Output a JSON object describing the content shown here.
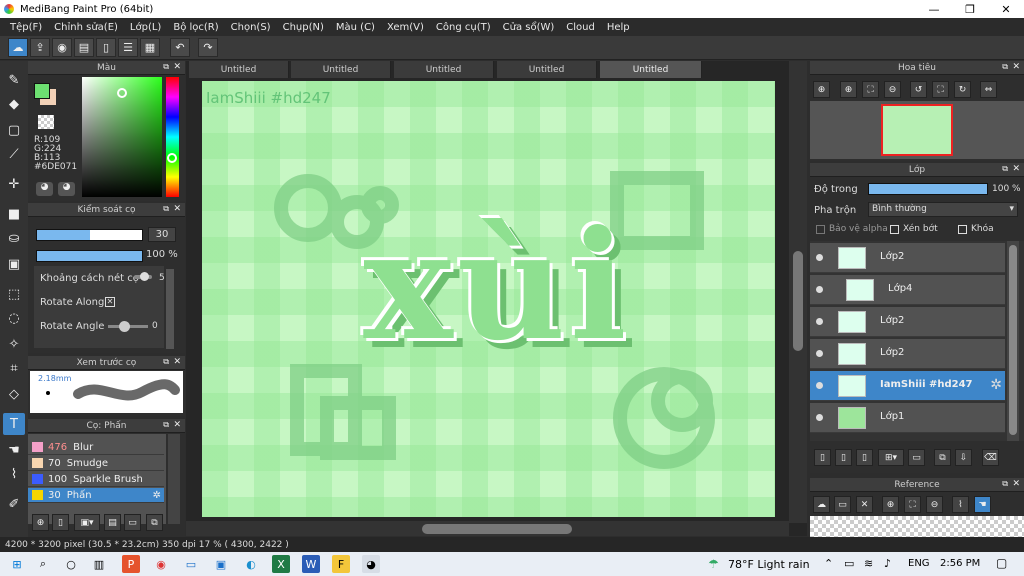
{
  "window": {
    "title": "MediBang Paint Pro (64bit)",
    "minimize": "—",
    "maximize": "❐",
    "close": "✕"
  },
  "menu": [
    "Tệp(F)",
    "Chỉnh sửa(E)",
    "Lớp(L)",
    "Bộ lọc(R)",
    "Chọn(S)",
    "Chụp(N)",
    "Màu (C)",
    "Xem(V)",
    "Công cụ(T)",
    "Cửa sổ(W)",
    "Cloud",
    "Help"
  ],
  "tabs": [
    "Untitled",
    "Untitled",
    "Untitled",
    "Untitled",
    "Untitled"
  ],
  "color_panel": {
    "title": "Màu",
    "r": "R:109",
    "g": "G:224",
    "b": "B:113",
    "hex": "#6DE071",
    "fg": "#6de071",
    "bg": "#f2d1b7"
  },
  "brush_control": {
    "title": "Kiểm soát cọ",
    "size": "30",
    "opacity_pct": "100 %",
    "size_fraction": 0.5,
    "opacity_fraction": 1.0,
    "spacing_label": "Khoảng cách nét cọ",
    "spacing_value": "5",
    "rotate_along_label": "Rotate Along",
    "rotate_angle_label": "Rotate Angle",
    "rotate_angle_value": "0"
  },
  "preview": {
    "title": "Xem trước cọ",
    "size": "2.18mm"
  },
  "brush_list": {
    "title": "Cọ: Phấn",
    "items": [
      {
        "num": "476",
        "name": "Blur",
        "color": "#f4a0c8"
      },
      {
        "num": "70",
        "name": "Smudge",
        "color": "#f8d6b0"
      },
      {
        "num": "100",
        "name": "Sparkle Brush",
        "color": "#3b5cff"
      },
      {
        "num": "30",
        "name": "Phấn",
        "color": "#f6d500"
      }
    ]
  },
  "canvas": {
    "watermark": "IamShiii #hd247",
    "art_text": "xùi"
  },
  "navigator": {
    "title": "Hoa tiêu"
  },
  "layers": {
    "title": "Lớp",
    "opacity_label": "Độ trong",
    "opacity_value": "100 %",
    "opacity_fraction": 1.0,
    "blend_label": "Pha trộn",
    "blend_value": "Bình thường",
    "protect_alpha": "Bảo vệ alpha",
    "clip": "Xén bớt",
    "lock": "Khóa",
    "rows": [
      {
        "name": "Lớp2",
        "selected": false
      },
      {
        "name": "Lớp4",
        "selected": false
      },
      {
        "name": "Lớp2",
        "selected": false
      },
      {
        "name": "Lớp2",
        "selected": false
      },
      {
        "name": "IamShiii #hd247",
        "selected": true
      },
      {
        "name": "Lớp1",
        "selected": false
      }
    ]
  },
  "reference": {
    "title": "Reference"
  },
  "status": {
    "text": "4200 * 3200 pixel  (30.5 * 23.2cm)  350 dpi  17 %  ( 4300, 2422 )"
  },
  "taskbar": {
    "weather": "78°F  Light rain",
    "lang": "ENG",
    "time": "2:56 PM"
  }
}
